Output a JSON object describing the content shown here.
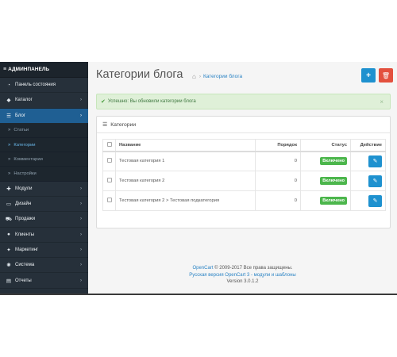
{
  "sidebar": {
    "header": "АДМИНПАНЕЛЬ",
    "items": [
      {
        "label": "Панель состояния",
        "icon": "dashboard-icon",
        "glyph": "◔"
      },
      {
        "label": "Каталог",
        "icon": "tag-icon",
        "glyph": "◆"
      },
      {
        "label": "Блог",
        "icon": "list-icon",
        "glyph": "☰"
      },
      {
        "label": "Модули",
        "icon": "puzzle-icon",
        "glyph": "✚"
      },
      {
        "label": "Дизайн",
        "icon": "monitor-icon",
        "glyph": "▭"
      },
      {
        "label": "Продажи",
        "icon": "cart-icon",
        "glyph": "⛟"
      },
      {
        "label": "Клиенты",
        "icon": "user-icon",
        "glyph": "●"
      },
      {
        "label": "Маркетинг",
        "icon": "share-icon",
        "glyph": "✦"
      },
      {
        "label": "Система",
        "icon": "cog-icon",
        "glyph": "✺"
      },
      {
        "label": "Отчеты",
        "icon": "bar-chart-icon",
        "glyph": "▤"
      }
    ],
    "blog_sub": [
      "Статьи",
      "Категории",
      "Комментарии",
      "Настройки"
    ]
  },
  "page": {
    "title": "Категории блога",
    "breadcrumb": "Категории блога"
  },
  "alert": {
    "text": "Успешно: Вы обновили категории блога",
    "close": "×"
  },
  "panel": {
    "title": "Категории",
    "columns": {
      "name": "Название",
      "sort": "Порядок",
      "status": "Статус",
      "action": "Действие"
    },
    "rows": [
      {
        "name": "Тестовая категория 1",
        "sort": "0",
        "status": "Включено"
      },
      {
        "name": "Тестовая категория 2",
        "sort": "0",
        "status": "Включено"
      },
      {
        "name": "Тестовая категория 2 > Тестовая подкатегория",
        "sort": "0",
        "status": "Включено"
      }
    ]
  },
  "footer": {
    "brand": "OpenCart",
    "copyright": " © 2009-2017 Все права защищены.",
    "version_link": "Русская версия OpenCart 3 - модули и шаблоны",
    "version": "Version 3.0.1.2"
  },
  "colors": {
    "sidebar_bg": "#26303a",
    "active_item": "#1f5f93",
    "primary_button": "#1e91cf",
    "danger_button": "#e3503e",
    "status_badge": "#4cb64c",
    "alert_bg": "#dff0d8"
  }
}
